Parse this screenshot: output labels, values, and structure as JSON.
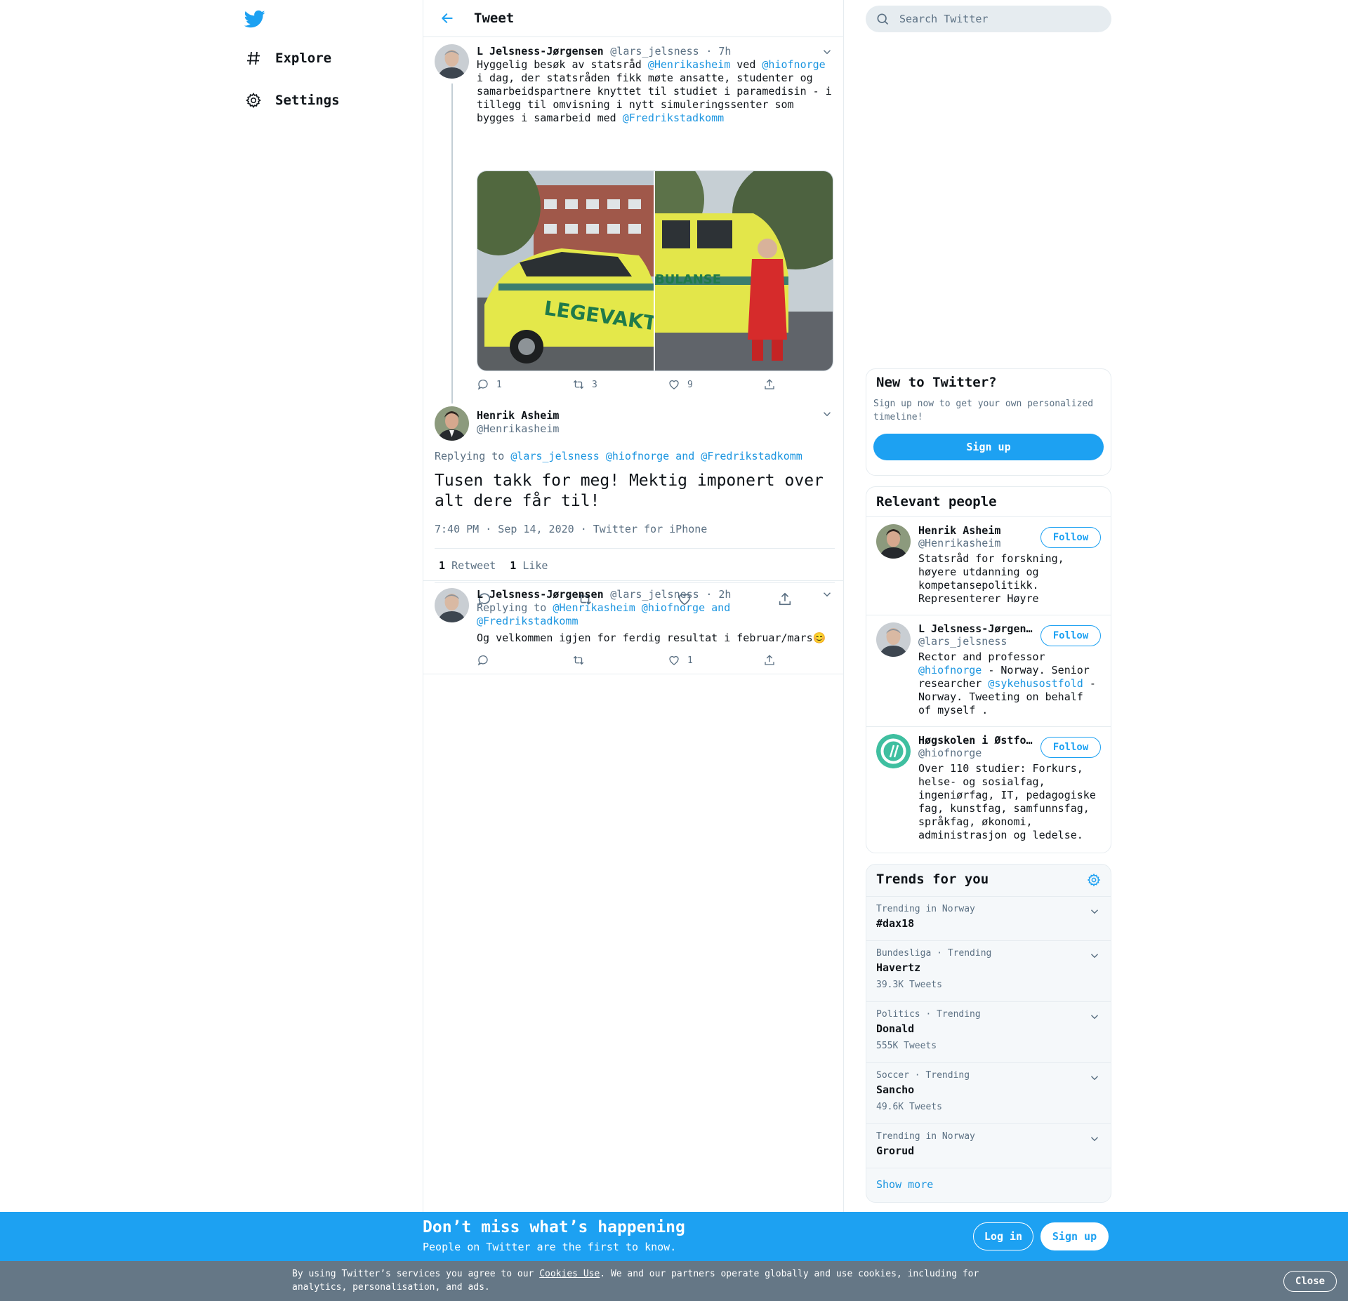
{
  "nav": {
    "items": [
      {
        "label": "Explore"
      },
      {
        "label": "Settings"
      }
    ]
  },
  "header": {
    "title": "Tweet"
  },
  "thread": {
    "parent": {
      "name": "L Jelsness-Jørgensen",
      "handle": "@lars_jelsness",
      "time": "· 7h",
      "text_parts": [
        "Hyggelig besøk av statsråd ",
        "@Henrikasheim",
        " ved ",
        "@hiofnorge",
        " i dag, der statsråden fikk møte ansatte, studenter og samarbeidspartnere knyttet til studiet i paramedisin - i tillegg til omvisning i nytt simuleringssenter som bygges i samarbeid med ",
        "@Fredrikstadkomm"
      ],
      "media_labels": [
        "LEGEVAKT",
        "BULANSE"
      ],
      "reply_count": "1",
      "retweet_count": "3",
      "like_count": "9"
    },
    "main": {
      "name": "Henrik Asheim",
      "handle": "@Henrikasheim",
      "replying_prefix": "Replying to ",
      "replying_to": "@lars_jelsness @hiofnorge and @Fredrikstadkomm",
      "text": "Tusen takk for meg! Mektig imponert over alt dere får til!",
      "timestamp": "7:40 PM · Sep 14, 2020",
      "source": "· Twitter for iPhone",
      "retweets_num": "1",
      "retweets_label": "Retweet",
      "likes_num": "1",
      "likes_label": "Like"
    },
    "reply": {
      "name": "L Jelsness-Jørgensen",
      "handle": "@lars_jelsness",
      "time": "· 2h",
      "replying_prefix": "Replying to ",
      "replying_to_line1": "@Henrikasheim @hiofnorge and",
      "replying_to_line2": "@Fredrikstadkomm",
      "text": "Og velkommen igjen for ferdig resultat i februar/mars😊",
      "like_count": "1"
    }
  },
  "search": {
    "placeholder": "Search Twitter"
  },
  "new_to_twitter": {
    "title": "New to Twitter?",
    "text": "Sign up now to get your own personalized timeline!",
    "button": "Sign up"
  },
  "relevant_people": {
    "title": "Relevant people",
    "follow_label": "Follow",
    "people": [
      {
        "name": "Henrik Asheim",
        "handle": "@Henrikasheim",
        "bio": "Statsråd for forskning, høyere utdanning og kompetansepolitikk. Representerer Høyre"
      },
      {
        "name": "L Jelsness-Jørgensen",
        "handle": "@lars_jelsness",
        "bio_parts": [
          "Rector and professor ",
          "@hiofnorge",
          " - Norway. Senior researcher ",
          "@sykehusostfold",
          " - Norway. Tweeting on behalf of myself ."
        ]
      },
      {
        "name": "Høgskolen i Østfold",
        "handle": "@hiofnorge",
        "bio": "Over 110 studier: Forkurs, helse- og sosialfag, ingeniørfag, IT, pedagogiske fag, kunstfag, samfunnsfag, språkfag, økonomi, administrasjon og ledelse."
      }
    ]
  },
  "trends": {
    "title": "Trends for you",
    "items": [
      {
        "context": "Trending in Norway",
        "name": "#dax18",
        "count": ""
      },
      {
        "context": "Bundesliga · Trending",
        "name": "Havertz",
        "count": "39.3K Tweets"
      },
      {
        "context": "Politics · Trending",
        "name": "Donald",
        "count": "555K Tweets"
      },
      {
        "context": "Soccer · Trending",
        "name": "Sancho",
        "count": "49.6K Tweets"
      },
      {
        "context": "Trending in Norway",
        "name": "Grorud",
        "count": ""
      }
    ],
    "show_more": "Show more"
  },
  "banner": {
    "heading": "Don’t miss what’s happening",
    "subheading": "People on Twitter are the first to know.",
    "login": "Log in",
    "signup": "Sign up"
  },
  "cookie": {
    "text_before": "By using Twitter’s services you agree to our ",
    "link": "Cookies Use",
    "text_after": ". We and our partners operate globally and use cookies, including for analytics, personalisation, and ads.",
    "close": "Close"
  },
  "colors": {
    "accent": "#1da1f2",
    "link": "#1b95e0",
    "muted": "#5b7083",
    "cookie_bg": "#657786"
  }
}
